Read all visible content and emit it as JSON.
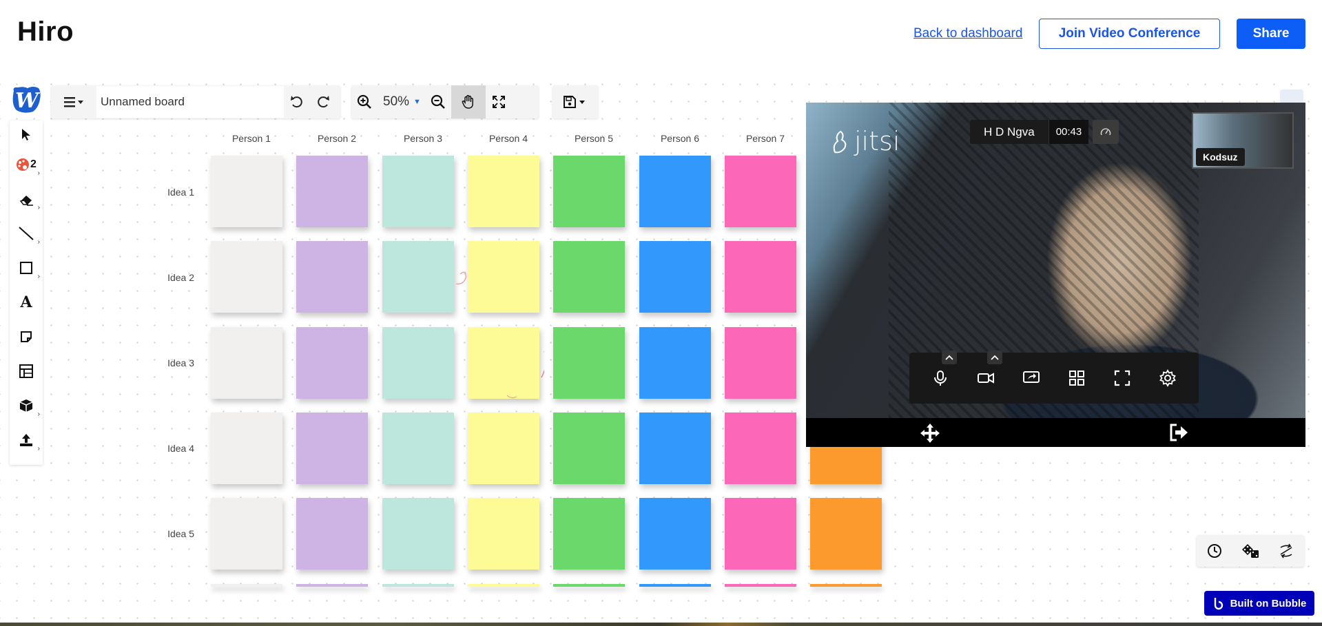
{
  "header": {
    "title": "Hiro",
    "back_link": "Back to dashboard",
    "join_button": "Join Video Conference",
    "share_button": "Share"
  },
  "board": {
    "name": "Unnamed board",
    "zoom": "50%"
  },
  "left_tools": [
    {
      "icon": "pointer-icon"
    },
    {
      "icon": "palette-icon",
      "badge": "2"
    },
    {
      "icon": "eraser-icon"
    },
    {
      "icon": "line-icon"
    },
    {
      "icon": "rectangle-icon"
    },
    {
      "icon": "text-icon",
      "glyph": "A"
    },
    {
      "icon": "sticky-note-icon"
    },
    {
      "icon": "template-icon"
    },
    {
      "icon": "cube-icon"
    },
    {
      "icon": "upload-icon"
    }
  ],
  "grid": {
    "columns": [
      "Person 1",
      "Person 2",
      "Person 3",
      "Person 4",
      "Person 5",
      "Person 6",
      "Person 7"
    ],
    "rows": [
      "Idea 1",
      "Idea 2",
      "Idea 3",
      "Idea 4",
      "Idea 5"
    ],
    "colors": [
      "#f1f0ef",
      "#cdb4e4",
      "#bde6dc",
      "#fdfb95",
      "#6ad86a",
      "#3398fb",
      "#fd67b8",
      "#fd9a2e"
    ]
  },
  "video": {
    "brand": "jitsi",
    "participant_name": "H D Ngva",
    "timer": "00:43",
    "thumbnail_name": "Kodsuz"
  },
  "footer": {
    "built_on": "Built on Bubble"
  }
}
